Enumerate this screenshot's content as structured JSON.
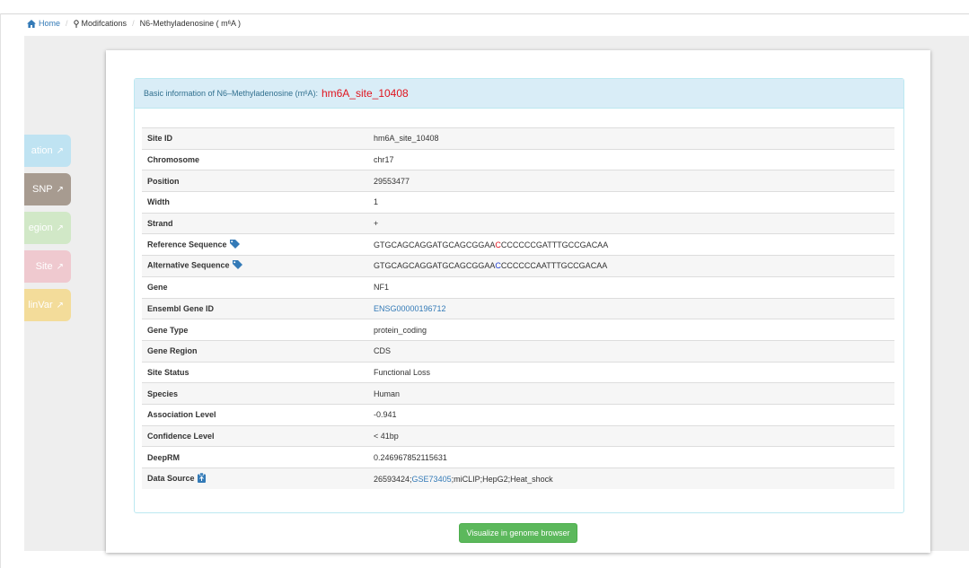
{
  "breadcrumb": {
    "home": "Home",
    "modifications": "Modifcations",
    "current_prefix": "N6-Methyladenosine ( m",
    "current_sup": "6",
    "current_suffix": "A )"
  },
  "side_tabs": [
    {
      "label": "ation",
      "color": "#bfe3f2"
    },
    {
      "label": "SNP",
      "color": "#a79b90"
    },
    {
      "label": "egion",
      "color": "#d1e8c7"
    },
    {
      "label": "Site",
      "color": "#efc9cf"
    },
    {
      "label": "linVar",
      "color": "#f3dc9a"
    }
  ],
  "panel": {
    "heading_prefix": "Basic information of N6–Methyladenosine (m",
    "heading_sup": "6",
    "heading_suffix": "A):",
    "site_name": "hm6A_site_10408"
  },
  "rows": {
    "site_id": {
      "label": "Site ID",
      "value": "hm6A_site_10408"
    },
    "chromosome": {
      "label": "Chromosome",
      "value": "chr17"
    },
    "position": {
      "label": "Position",
      "value": "29553477"
    },
    "width": {
      "label": "Width",
      "value": "1"
    },
    "strand": {
      "label": "Strand",
      "value": "+"
    },
    "reference_sequence": {
      "label": "Reference Sequence",
      "before": "GTGCAGCAGGATGCAGCGGAA",
      "highlight": "C",
      "after": "CCCCCCGATTTGCCGACAA"
    },
    "alternative_sequence": {
      "label": "Alternative Sequence",
      "before": "GTGCAGCAGGATGCAGCGGAA",
      "highlight": "C",
      "after": "CCCCCCAATTTGCCGACAA"
    },
    "gene": {
      "label": "Gene",
      "value": "NF1"
    },
    "ensembl_gene_id": {
      "label": "Ensembl Gene ID",
      "value": "ENSG00000196712"
    },
    "gene_type": {
      "label": "Gene Type",
      "value": "protein_coding"
    },
    "gene_region": {
      "label": "Gene Region",
      "value": "CDS"
    },
    "site_status": {
      "label": "Site Status",
      "value": "Functional Loss"
    },
    "species": {
      "label": "Species",
      "value": "Human"
    },
    "association_level": {
      "label": "Association Level",
      "value": "-0.941"
    },
    "confidence_level": {
      "label": "Confidence Level",
      "value": "< 41bp"
    },
    "deeprm": {
      "label": "DeepRM",
      "value": "0.246967852115631"
    },
    "data_source": {
      "label": "Data Source",
      "pmid": "26593424;",
      "gse": "GSE73405",
      "rest": ";miCLIP;HepG2;Heat_shock"
    }
  },
  "button": {
    "label": "Visualize in genome browser"
  },
  "colors": {
    "accent_red": "#e0141e",
    "link_blue": "#337ab7",
    "button_green": "#5cb85c",
    "heading_bg": "#d9edf7"
  }
}
